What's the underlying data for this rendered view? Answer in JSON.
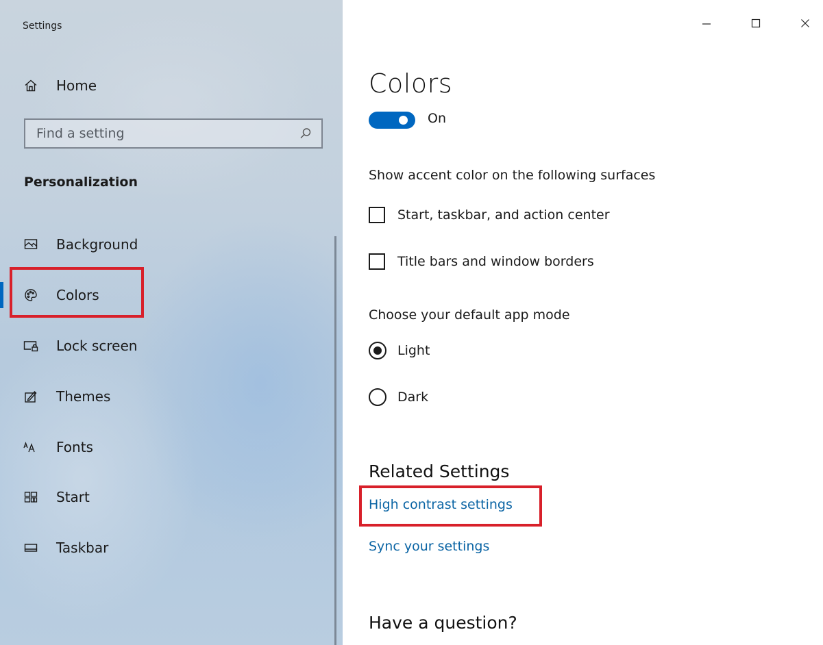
{
  "window": {
    "app_title": "Settings",
    "controls": {
      "minimize_icon": "minimize-icon",
      "maximize_icon": "maximize-icon",
      "close_icon": "close-icon"
    }
  },
  "sidebar": {
    "home": {
      "label": "Home",
      "icon": "home-icon"
    },
    "search": {
      "placeholder": "Find a setting",
      "icon": "search-icon"
    },
    "section_heading": "Personalization",
    "items": [
      {
        "label": "Background",
        "icon": "background-icon",
        "selected": false
      },
      {
        "label": "Colors",
        "icon": "palette-icon",
        "selected": true
      },
      {
        "label": "Lock screen",
        "icon": "lock-screen-icon",
        "selected": false
      },
      {
        "label": "Themes",
        "icon": "themes-icon",
        "selected": false
      },
      {
        "label": "Fonts",
        "icon": "fonts-icon",
        "selected": false
      },
      {
        "label": "Start",
        "icon": "start-icon",
        "selected": false
      },
      {
        "label": "Taskbar",
        "icon": "taskbar-icon",
        "selected": false
      }
    ]
  },
  "main": {
    "title": "Colors",
    "toggle": {
      "state": "On",
      "checked": true
    },
    "accent_heading": "Show accent color on the following surfaces",
    "checkboxes": [
      {
        "label": "Start, taskbar, and action center",
        "checked": false
      },
      {
        "label": "Title bars and window borders",
        "checked": false
      }
    ],
    "app_mode_heading": "Choose your default app mode",
    "app_mode_options": [
      {
        "label": "Light",
        "selected": true
      },
      {
        "label": "Dark",
        "selected": false
      }
    ],
    "related_heading": "Related Settings",
    "links": {
      "high_contrast": "High contrast settings",
      "sync": "Sync your settings"
    },
    "question_heading": "Have a question?"
  },
  "colors": {
    "accent": "#0067c0",
    "link": "#0a64a4",
    "highlight_box": "#d8202a"
  }
}
